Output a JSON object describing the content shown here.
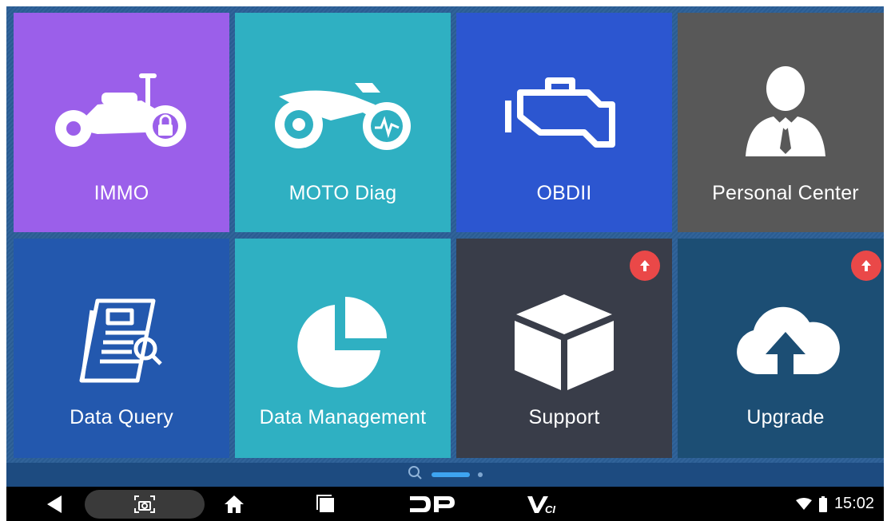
{
  "tiles": [
    {
      "label": "IMMO",
      "icon": "motorcycle-lock-icon",
      "color": "#9b5fea"
    },
    {
      "label": "MOTO Diag",
      "icon": "dirt-bike-icon",
      "color": "#2fb0c2"
    },
    {
      "label": "OBDII",
      "icon": "engine-icon",
      "color": "#2c56d0"
    },
    {
      "label": "Personal Center",
      "icon": "person-icon",
      "color": "#585858"
    },
    {
      "label": "Data Query",
      "icon": "document-search-icon",
      "color": "#2358ae"
    },
    {
      "label": "Data Management",
      "icon": "pie-chart-icon",
      "color": "#2fb0c2"
    },
    {
      "label": "Support",
      "icon": "box-icon",
      "color": "#393d49"
    },
    {
      "label": "Upgrade",
      "icon": "cloud-upload-icon",
      "color": "#1c4e74"
    }
  ],
  "badges": {
    "support": "update-badge-icon",
    "upgrade": "update-badge-icon"
  },
  "pager": {
    "search_icon": "search-icon",
    "active_page": 1,
    "page_count": 2
  },
  "navbar": {
    "back": "back-icon",
    "screenshot": "screenshot-icon",
    "home": "home-icon",
    "recents": "recents-icon",
    "dp": "dp-logo-icon",
    "vci": "vci-logo-icon"
  },
  "status": {
    "wifi": "wifi-icon",
    "battery": "battery-icon",
    "time": "15:02"
  }
}
